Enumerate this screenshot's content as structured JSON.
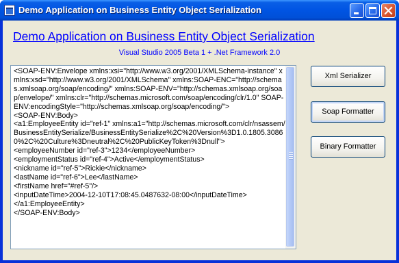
{
  "window": {
    "title": "Demo Application on Business Entity Object Serialization",
    "icons": [
      "app-icon",
      "minimize-icon",
      "maximize-icon",
      "close-icon"
    ]
  },
  "header": {
    "title": "Demo Application on Business Entity Object Serialization",
    "subtitle": "Visual Studio 2005 Beta 1 + .Net Framework 2.0"
  },
  "output": {
    "text": "<SOAP-ENV:Envelope xmlns:xsi=\"http://www.w3.org/2001/XMLSchema-instance\" xmlns:xsd=\"http://www.w3.org/2001/XMLSchema\" xmlns:SOAP-ENC=\"http://schemas.xmlsoap.org/soap/encoding/\" xmlns:SOAP-ENV=\"http://schemas.xmlsoap.org/soap/envelope/\" xmlns:clr=\"http://schemas.microsoft.com/soap/encoding/clr/1.0\" SOAP-ENV:encodingStyle=\"http://schemas.xmlsoap.org/soap/encoding/\">\n<SOAP-ENV:Body>\n<a1:EmployeeEntity id=\"ref-1\" xmlns:a1=\"http://schemas.microsoft.com/clr/nsassem/BusinessEntitySerialize/BusinessEntitySerialize%2C%20Version%3D1.0.1805.30860%2C%20Culture%3Dneutral%2C%20PublicKeyToken%3Dnull\">\n<employeeNumber id=\"ref-3\">1234</employeeNumber>\n<employmentStatus id=\"ref-4\">Active</employmentStatus>\n<nickname id=\"ref-5\">Rickie</nickname>\n<lastName id=\"ref-6\">Lee</lastName>\n<firstName href=\"#ref-5\"/>\n<inputDateTime>2004-12-10T17:08:45.0487632-08:00</inputDateTime>\n</a1:EmployeeEntity>\n</SOAP-ENV:Body>"
  },
  "buttons": {
    "xml_serializer": "Xml Serializer",
    "soap_formatter": "Soap Formatter",
    "binary_formatter": "Binary Formatter"
  },
  "colors": {
    "titlebar": "#0054e3",
    "client_bg": "#ece9d8",
    "link": "#0000ff"
  }
}
